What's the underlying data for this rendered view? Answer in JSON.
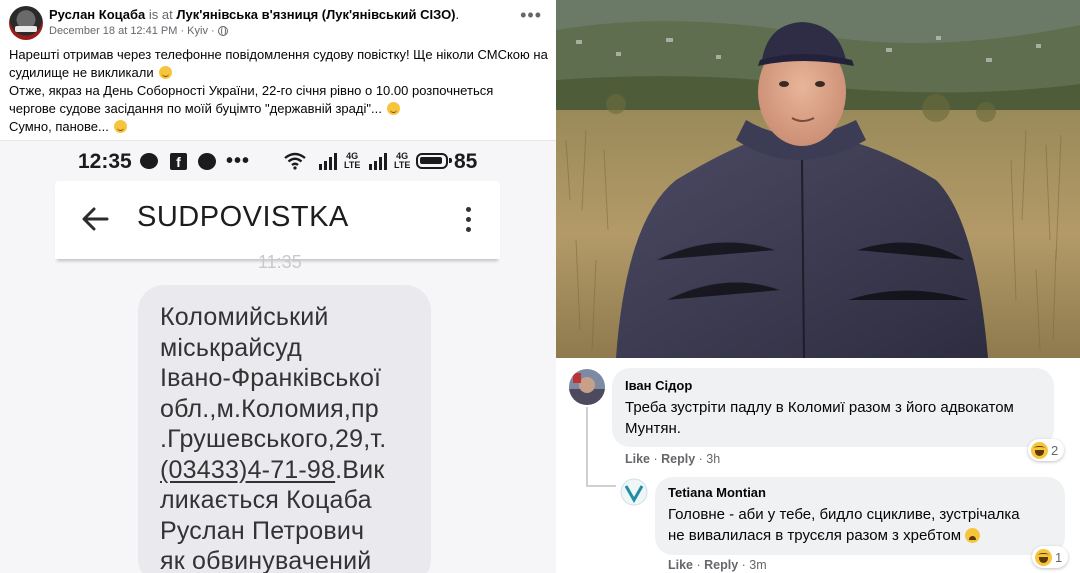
{
  "post": {
    "author": "Руслан Коцаба",
    "location_prefix": "is at",
    "location": "Лук'янівська в'язниця (Лук'янівський СІЗО)",
    "location_suffix": ".",
    "meta": "December 18 at 12:41 PM · Kyiv ·",
    "lines": [
      "Нарешті отримав через телефонне повідомлення судову повістку!  Ще ніколи СМСкою на",
      "судилище не викликали",
      "Отже,  якраз на День Соборності України,  22-го січня рівно о 10.00 розпочнеться",
      "чергове судове засідання по моїй буцімто \"державній зраді\"...",
      "Сумно, панове..."
    ]
  },
  "phone": {
    "time": "12:35",
    "battery": "85",
    "network_1": "4G\nLTE",
    "network_2": "4G\nLTE",
    "sender": "SUDPOVISTKA",
    "faded_time": "11:35",
    "message_lines": [
      "Коломийський",
      "міськрайсуд",
      "Івано-Франківської",
      "обл.,м.Коломия,пр",
      ".Грушевського,29,т."
    ],
    "phone_number": "(03433)4-71-98",
    "after_phone": ".Вик",
    "message_lines_2": [
      "ликається Коцаба",
      "Руслан Петрович",
      "як обвинувачений"
    ]
  },
  "comments": [
    {
      "author": "Іван Сідор",
      "lines": [
        "Треба зустріти падлу в Коломиї разом з його адвокатом",
        "Мунтян."
      ],
      "like": "Like",
      "reply": "Reply",
      "time": "3h",
      "reaction_count": "2"
    },
    {
      "author": "Tetiana Montian",
      "lines": [
        "Головне - аби у тебе, бидло сцикливе, зустрічалка",
        "не вивалилася в трусєля разом з хребтом"
      ],
      "like": "Like",
      "reply": "Reply",
      "time": "3m",
      "reaction_count": "1"
    }
  ],
  "colors": {
    "facebook_text": "#050505",
    "muted": "#65676b",
    "bubble": "#e9e9ee",
    "comment_bubble": "#eff1f3",
    "haha": "#f7c43e"
  }
}
